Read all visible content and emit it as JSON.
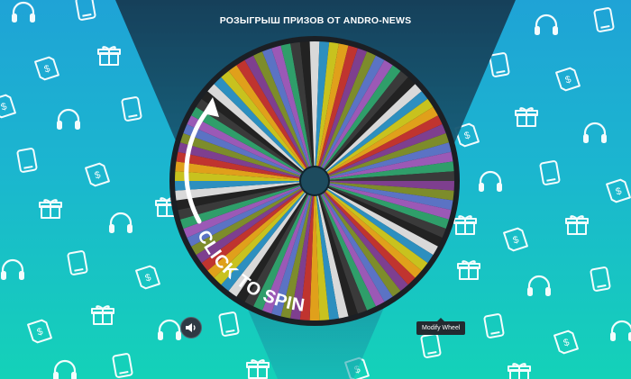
{
  "header": {
    "title": "РОЗЫГРЫШ ПРИЗОВ ОТ ANDRO-NEWS"
  },
  "wheel": {
    "cta_text": "CLICK TO SPIN",
    "segment_count": 90,
    "segment_colors": [
      "#7e3f8f",
      "#d9d9d9",
      "#5b73c4",
      "#c8c21e",
      "#2f9e6a",
      "#c0342f",
      "#222222",
      "#7d8c2b",
      "#2d8fbf",
      "#9b59b6",
      "#e0a01b",
      "#3a3a3a"
    ]
  },
  "controls": {
    "sound_button_label": "sound-toggle",
    "modify_tooltip": "Modify Wheel"
  },
  "colors": {
    "bg_top": "#1fa3d6",
    "bg_bottom": "#14d2b8",
    "spotlight": "#16405a"
  }
}
